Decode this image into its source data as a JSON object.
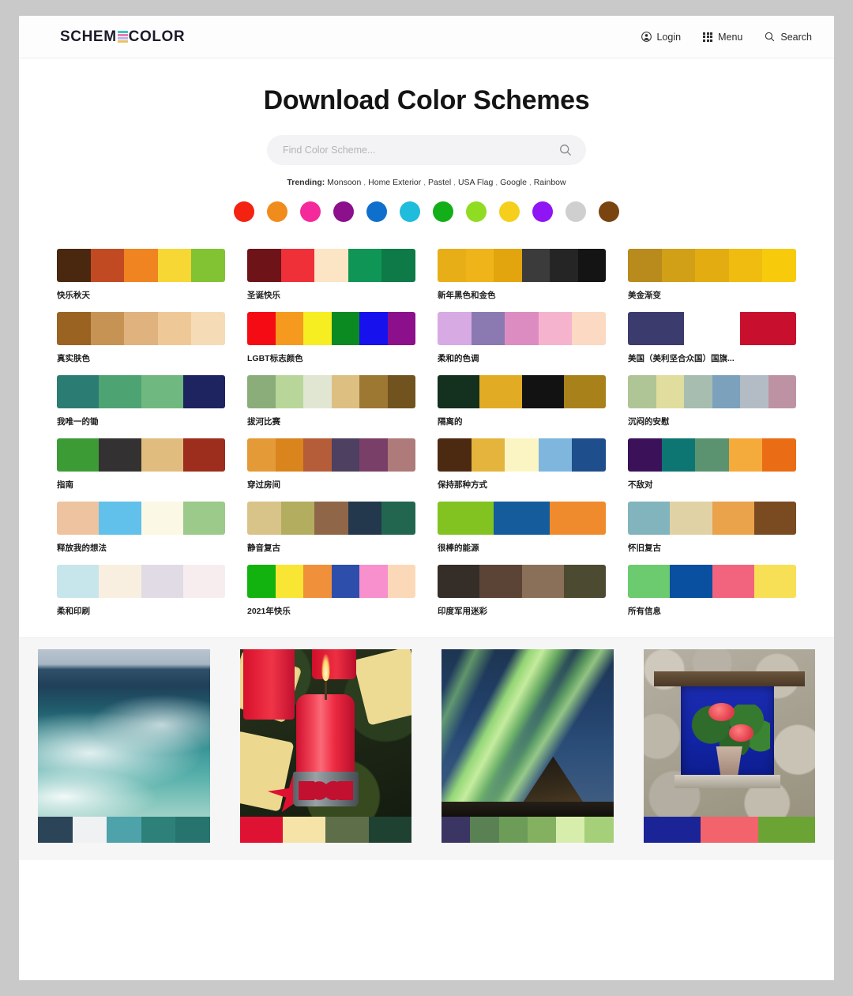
{
  "header": {
    "logo_part1": "SCHEM",
    "logo_part2": "COLOR",
    "login_label": "Login",
    "menu_label": "Menu",
    "search_label": "Search"
  },
  "hero": {
    "title": "Download Color Schemes",
    "search_placeholder": "Find Color Scheme...",
    "search_value": "",
    "trending_label": "Trending:",
    "trending_items": [
      "Monsoon",
      "Home Exterior",
      "Pastel",
      "USA Flag",
      "Google",
      "Rainbow"
    ],
    "color_filters": [
      {
        "name": "red",
        "hex": "#f42211"
      },
      {
        "name": "orange",
        "hex": "#f08c1c"
      },
      {
        "name": "pink",
        "hex": "#f42a9c"
      },
      {
        "name": "purple",
        "hex": "#8c0f8c"
      },
      {
        "name": "blue",
        "hex": "#0f6fcc"
      },
      {
        "name": "cyan",
        "hex": "#1fbcdc"
      },
      {
        "name": "green",
        "hex": "#12af18"
      },
      {
        "name": "lime",
        "hex": "#8fdc22"
      },
      {
        "name": "yellow",
        "hex": "#f5cf1b"
      },
      {
        "name": "violet",
        "hex": "#8f15f5"
      },
      {
        "name": "gray",
        "hex": "#cfcfcf"
      },
      {
        "name": "brown",
        "hex": "#7a4410"
      }
    ]
  },
  "palettes": [
    {
      "name": "快乐秋天",
      "colors": [
        "#4a2810",
        "#c24a22",
        "#ef8420",
        "#f7d734",
        "#81c333"
      ]
    },
    {
      "name": "圣诞快乐",
      "colors": [
        "#6e1318",
        "#ef3039",
        "#fbe5c4",
        "#0f9657",
        "#0d7a47"
      ]
    },
    {
      "name": "新年黑色和金色",
      "colors": [
        "#e8ae18",
        "#eeb419",
        "#e3a50e",
        "#3b3b3b",
        "#252525",
        "#141414"
      ]
    },
    {
      "name": "美金渐变",
      "colors": [
        "#b98a1c",
        "#d1a016",
        "#e3ad12",
        "#efbc0f",
        "#f7cb0c"
      ]
    },
    {
      "name": "真实肤色",
      "colors": [
        "#9a6322",
        "#c79354",
        "#e0b27e",
        "#efc897",
        "#f5dcb6"
      ]
    },
    {
      "name": "LGBT标志颜色",
      "colors": [
        "#f50b13",
        "#f59a1e",
        "#f7ee22",
        "#0c8a22",
        "#1712ed",
        "#8c0f8c"
      ]
    },
    {
      "name": "柔和的色调",
      "colors": [
        "#d7aae4",
        "#8b7ab2",
        "#dd8cc2",
        "#f6b3ce",
        "#fbd9c3"
      ]
    },
    {
      "name": "美国（美利坚合众国）国旗...",
      "colors": [
        "#3c3b6e",
        "#ffffff",
        "#c8102e"
      ]
    },
    {
      "name": "我唯一的锄",
      "colors": [
        "#2b7d73",
        "#4ea372",
        "#6fb880",
        "#1e2460"
      ]
    },
    {
      "name": "拔河比赛",
      "colors": [
        "#8aad79",
        "#b9d69a",
        "#e1e6d2",
        "#ddbf82",
        "#9c7833",
        "#71531f"
      ]
    },
    {
      "name": "隔离的",
      "colors": [
        "#14301f",
        "#e1ab24",
        "#121212",
        "#a8811b"
      ]
    },
    {
      "name": "沉闷的安慰",
      "colors": [
        "#b0c596",
        "#e0dd9e",
        "#a7bdb0",
        "#7ba1bc",
        "#b3bcc4",
        "#bd93a4"
      ]
    },
    {
      "name": "指南",
      "colors": [
        "#3d9b36",
        "#343132",
        "#e0bd7f",
        "#9d2d1d"
      ]
    },
    {
      "name": "穿过房间",
      "colors": [
        "#e49a36",
        "#d9841c",
        "#b55c38",
        "#4d4060",
        "#7a3f68",
        "#ae7b7a"
      ]
    },
    {
      "name": "保持那种方式",
      "colors": [
        "#4c2a12",
        "#e5b43d",
        "#fbf5c4",
        "#7eb6dd",
        "#1f4e8c"
      ]
    },
    {
      "name": "不敌对",
      "colors": [
        "#3b1159",
        "#0e7672",
        "#5b9370",
        "#f5ab3c",
        "#ea6c15"
      ]
    },
    {
      "name": "释放我的想法",
      "colors": [
        "#eec3a0",
        "#61c1ea",
        "#fbf8e6",
        "#9bca8a"
      ]
    },
    {
      "name": "静音复古",
      "colors": [
        "#d8c389",
        "#b3ad60",
        "#8f6647",
        "#23384c",
        "#22664f"
      ]
    },
    {
      "name": "很棒的能源",
      "colors": [
        "#82c322",
        "#155c9c",
        "#ef8b2c"
      ]
    },
    {
      "name": "怀旧复古",
      "colors": [
        "#82b4bd",
        "#e0d2a5",
        "#eaa24b",
        "#7a4a21"
      ]
    },
    {
      "name": "柔和印刷",
      "colors": [
        "#c7e6ec",
        "#f8efe0",
        "#e0dbe5",
        "#f7edee"
      ]
    },
    {
      "name": "2021年快乐",
      "colors": [
        "#13b30f",
        "#f8e534",
        "#f0903a",
        "#2d4fab",
        "#f790cd",
        "#fbd9b8"
      ]
    },
    {
      "name": "印度军用迷彩",
      "colors": [
        "#352d28",
        "#5b4436",
        "#8b7059",
        "#4d4a32"
      ]
    },
    {
      "name": "所有信息",
      "colors": [
        "#6ccb6f",
        "#0a50a0",
        "#f2647d",
        "#f7e055"
      ]
    }
  ],
  "photo_cards": [
    {
      "name": "ocean-wave-photo",
      "colors": [
        "#2c4458",
        "#f0f1f3",
        "#4ea2aa",
        "#2d8179",
        "#27736e"
      ]
    },
    {
      "name": "red-candle-photo",
      "colors": [
        "#e01234",
        "#f5e3a8",
        "#5e6e49",
        "#1f4132"
      ]
    },
    {
      "name": "aurora-photo",
      "colors": [
        "#3a3563",
        "#5a8153",
        "#6c9c58",
        "#83b15f",
        "#d6edab",
        "#a6cf7a"
      ]
    },
    {
      "name": "blue-window-photo",
      "colors": [
        "#1b2496",
        "#f2636b",
        "#6ba434"
      ]
    }
  ]
}
